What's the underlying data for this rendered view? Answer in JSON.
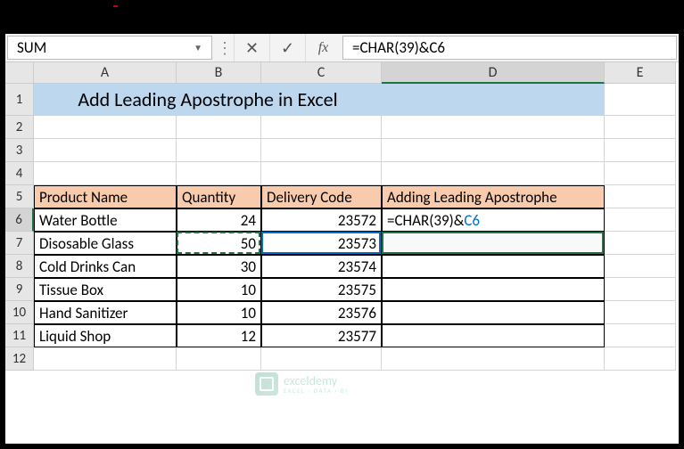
{
  "name_box": "SUM",
  "formula_bar": "=CHAR(39)&C6",
  "fb_cancel": "✕",
  "fb_enter": "✓",
  "fb_fx": "fx",
  "cols": {
    "A": "A",
    "B": "B",
    "C": "C",
    "D": "D",
    "E": "E"
  },
  "rows": [
    "1",
    "2",
    "3",
    "4",
    "5",
    "6",
    "7",
    "8",
    "9",
    "10",
    "11",
    "12"
  ],
  "title": "Add Leading Apostrophe in Excel",
  "headers": {
    "product": "Product Name",
    "qty": "Quantity",
    "code": "Delivery Code",
    "result": "Adding Leading Apostrophe"
  },
  "table": [
    {
      "product": "Water Bottle",
      "qty": "24",
      "code": "23572"
    },
    {
      "product": "Disosable Glass",
      "qty": "50",
      "code": "23573"
    },
    {
      "product": "Cold Drinks Can",
      "qty": "30",
      "code": "23574"
    },
    {
      "product": "Tissue Box",
      "qty": "10",
      "code": "23575"
    },
    {
      "product": "Hand Sanitizer",
      "qty": "10",
      "code": "23576"
    },
    {
      "product": "Liquid Shop",
      "qty": "12",
      "code": "23577"
    }
  ],
  "cell_formula": {
    "fn": "=CHAR(39)&",
    "ref": "C6"
  },
  "watermark": {
    "brand": "exceldemy",
    "tag": "EXCEL · DATA · BI"
  }
}
